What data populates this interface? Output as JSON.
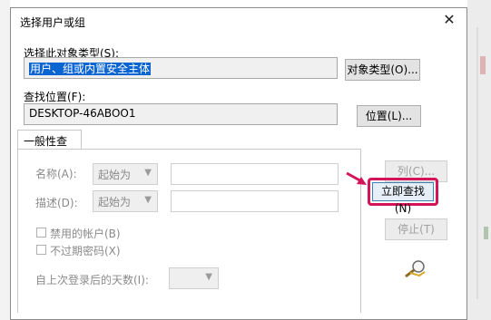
{
  "dialog": {
    "title": "选择用户或组",
    "close_glyph": "✕"
  },
  "object_type": {
    "label": "选择此对象类型(S):",
    "value": "用户、组或内置安全主体",
    "button": "对象类型(O)..."
  },
  "location": {
    "label": "查找位置(F):",
    "value": "DESKTOP-46ABOO1",
    "button": "位置(L)..."
  },
  "tabs": [
    {
      "label": "一般性查询",
      "selected": true
    }
  ],
  "query": {
    "name_label": "名称(A):",
    "name_mode": "起始为",
    "name_value": "",
    "desc_label": "描述(D):",
    "desc_mode": "起始为",
    "desc_value": "",
    "disabled_accounts": {
      "label": "禁用的帐户(B)",
      "checked": false
    },
    "non_expiring_pwd": {
      "label": "不过期密码(X)",
      "checked": false
    },
    "days_since_logon_label": "自上次登录后的天数(I):",
    "days_since_logon_value": ""
  },
  "side_buttons": {
    "columns": "列(C)...",
    "find_now": "立即查找(N)",
    "stop": "停止(T)"
  },
  "icons": {
    "dropdown": "chevron-down-icon",
    "search_anim": "magnifier-icon",
    "highlight_color": "#d4145a"
  }
}
